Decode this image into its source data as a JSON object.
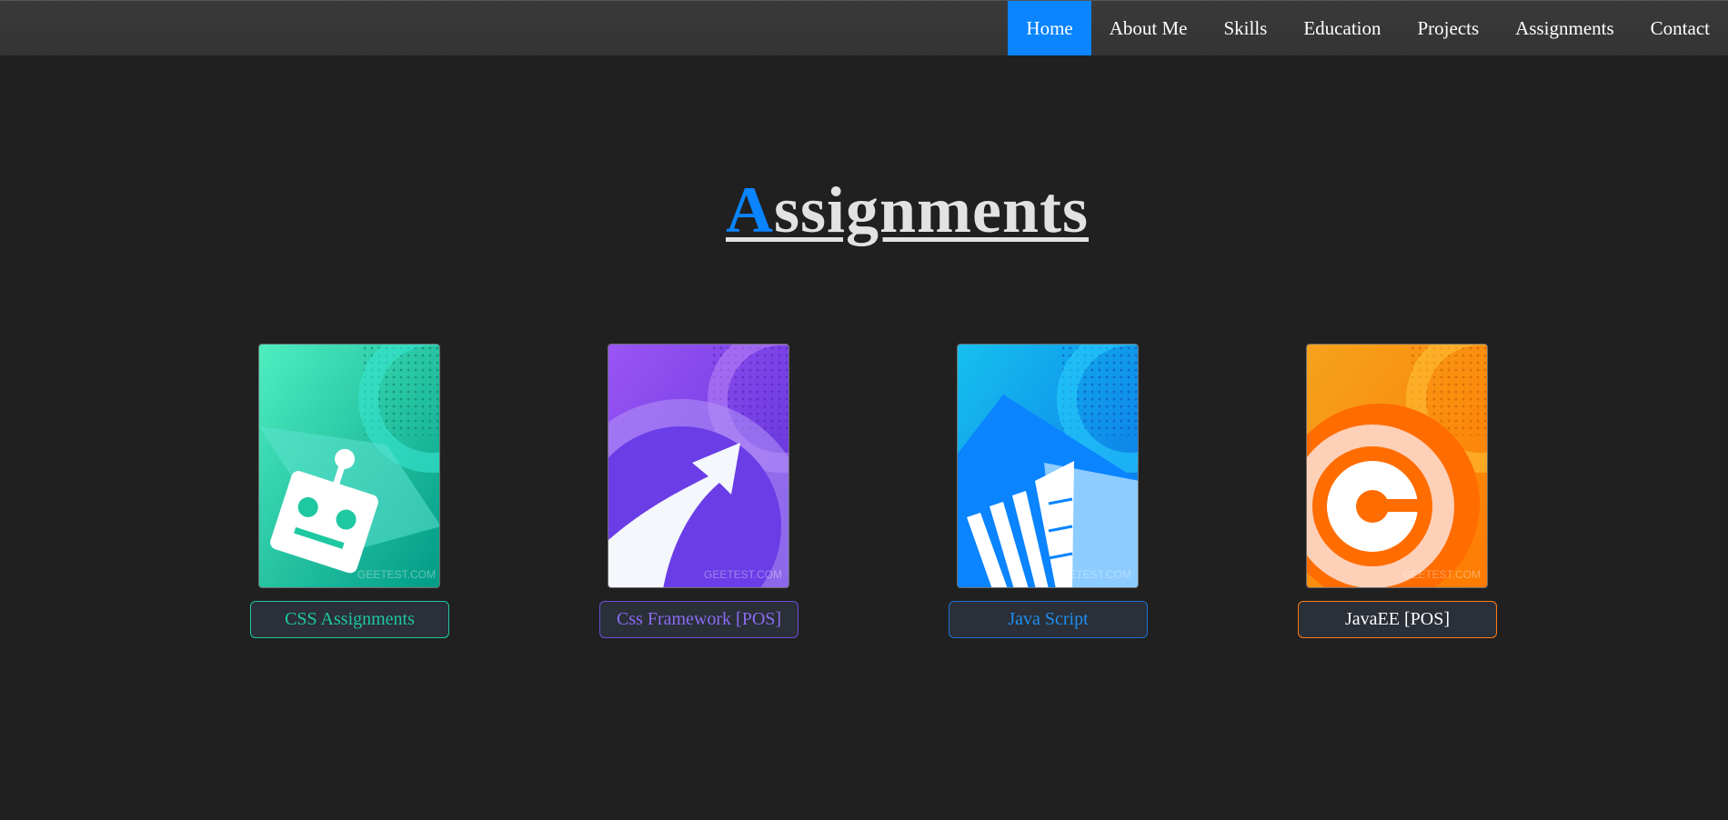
{
  "nav": {
    "items": [
      {
        "label": "Home",
        "active": true
      },
      {
        "label": "About Me",
        "active": false
      },
      {
        "label": "Skills",
        "active": false
      },
      {
        "label": "Education",
        "active": false
      },
      {
        "label": "Projects",
        "active": false
      },
      {
        "label": "Assignments",
        "active": false
      },
      {
        "label": "Contact",
        "active": false
      }
    ],
    "active_color": "#0a84ff"
  },
  "page": {
    "title_first_letter": "A",
    "title_rest": "ssignments",
    "accent": "#0a84ff"
  },
  "cards": [
    {
      "icon": "robot-icon",
      "button_label": "CSS Assignments",
      "color": "#1ec8a0",
      "watermark": "GEETEST.COM"
    },
    {
      "icon": "arrow-icon",
      "button_label": "Css Framework [POS]",
      "color": "#8a6cf0",
      "watermark": "GEETEST.COM"
    },
    {
      "icon": "pen-icon",
      "button_label": "Java Script",
      "color": "#1e8ff0",
      "watermark": "GEETEST.COM"
    },
    {
      "icon": "target-icon",
      "button_label": "JavaEE [POS]",
      "color": "#ff7a1a",
      "watermark": "GEETEST.COM"
    }
  ]
}
